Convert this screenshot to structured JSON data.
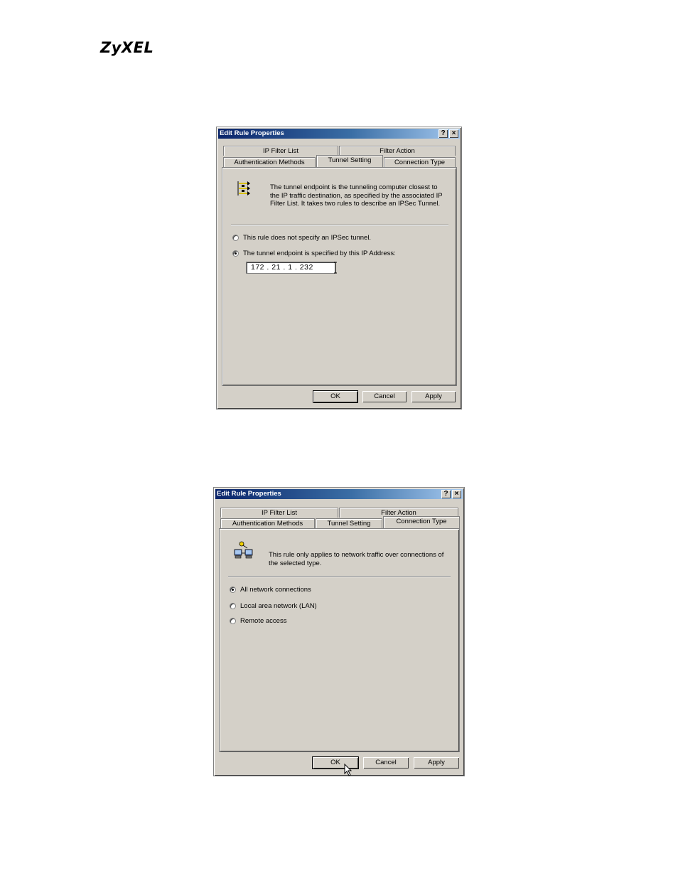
{
  "brand": "ZyXEL",
  "dialog1": {
    "title": "Edit Rule Properties",
    "help_btn": "?",
    "close_btn": "×",
    "tabs_back": [
      "IP Filter List",
      "Filter Action"
    ],
    "tabs_front": [
      "Authentication Methods",
      "Tunnel Setting",
      "Connection Type"
    ],
    "active_tab": "Tunnel Setting",
    "desc": "The tunnel endpoint is the tunneling computer closest to the IP traffic destination, as specified by the associated IP Filter List. It takes two rules to describe an IPSec Tunnel.",
    "option1": "This rule does not specify an IPSec tunnel.",
    "option2": "The tunnel endpoint is specified by this IP Address:",
    "ip": "172 . 21 . 1 . 232",
    "ok": "OK",
    "cancel": "Cancel",
    "apply": "Apply"
  },
  "dialog2": {
    "title": "Edit Rule Properties",
    "help_btn": "?",
    "close_btn": "×",
    "tabs_back": [
      "IP Filter List",
      "Filter Action"
    ],
    "tabs_front": [
      "Authentication Methods",
      "Tunnel Setting",
      "Connection Type"
    ],
    "active_tab": "Connection Type",
    "desc": "This rule only applies to network traffic over connections of the selected type.",
    "option1": "All network connections",
    "option2": "Local area network (LAN)",
    "option3": "Remote access",
    "ok": "OK",
    "cancel": "Cancel",
    "apply": "Apply"
  }
}
